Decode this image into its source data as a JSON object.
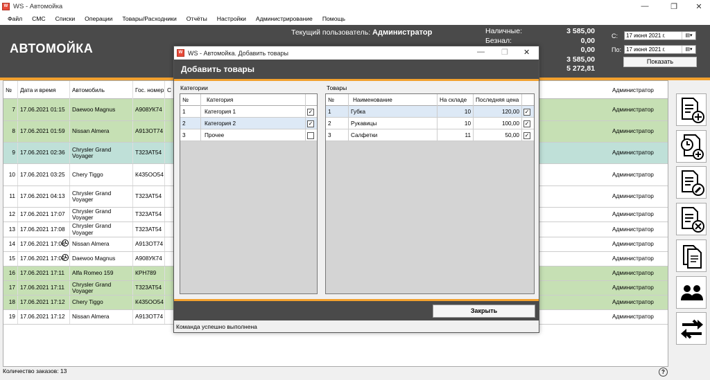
{
  "window": {
    "title": "WS - Автомойка",
    "minimize": "—",
    "maximize": "❐",
    "close": "✕"
  },
  "menu": [
    "Файл",
    "СМС",
    "Списки",
    "Операции",
    "Товары/Расходники",
    "Отчёты",
    "Настройки",
    "Администрирование",
    "Помощь"
  ],
  "header": {
    "app_title": "АВТОМОЙКА",
    "user_label": "Текущий пользователь:",
    "user_value": "Администратор",
    "cash": [
      {
        "label": "Наличные:",
        "value": "3 585,00"
      },
      {
        "label": "Безнал:",
        "value": "0,00"
      },
      {
        "label": "",
        "value": "0,00"
      },
      {
        "label": "",
        "value": "3 585,00"
      },
      {
        "label": "",
        "value": "5 272,81"
      }
    ],
    "date_from_label": "С:",
    "date_from": "17   июня   2021 г.",
    "date_to_label": "По:",
    "date_to": "17   июня   2021 г.",
    "show_button": "Показать"
  },
  "grid": {
    "columns": [
      "№",
      "Дата и время",
      "Автомобиль",
      "Гос. номер",
      "С",
      "Администратор"
    ],
    "rows": [
      {
        "n": "7",
        "dt": "17.06.2021 01:15",
        "car": "Daewoo Magnus",
        "plate": "А908УК74",
        "admin": "Администратор",
        "color": "#c6e0b4",
        "clock": false
      },
      {
        "n": "8",
        "dt": "17.06.2021 01:59",
        "car": "Nissan Almera",
        "plate": "А913ОТ74",
        "admin": "Администратор",
        "color": "#c6e0b4",
        "clock": false
      },
      {
        "n": "9",
        "dt": "17.06.2021 02:36",
        "car": "Chrysler Grand Voyager",
        "plate": "Т323АТ54",
        "admin": "Администратор",
        "color": "#bfe0d8",
        "clock": false
      },
      {
        "n": "10",
        "dt": "17.06.2021 03:25",
        "car": "Chery Tiggo",
        "plate": "К435ОО54",
        "admin": "Администратор",
        "color": "#ffffff",
        "clock": false
      },
      {
        "n": "11",
        "dt": "17.06.2021 04:13",
        "car": "Chrysler Grand Voyager",
        "plate": "Т323АТ54",
        "admin": "Администратор",
        "color": "#ffffff",
        "clock": false
      },
      {
        "n": "12",
        "dt": "17.06.2021 17:07",
        "car": "Chrysler Grand Voyager",
        "plate": "Т323АТ54",
        "admin": "Администратор",
        "color": "#ffffff",
        "clock": false
      },
      {
        "n": "13",
        "dt": "17.06.2021 17:08",
        "car": "Chrysler Grand Voyager",
        "plate": "Т323АТ54",
        "admin": "Администратор",
        "color": "#ffffff",
        "clock": false
      },
      {
        "n": "14",
        "dt": "17.06.2021 17:08",
        "car": "Nissan Almera",
        "plate": "А913ОТ74",
        "admin": "Администратор",
        "color": "#ffffff",
        "clock": true
      },
      {
        "n": "15",
        "dt": "17.06.2021 17:09",
        "car": "Daewoo Magnus",
        "plate": "А908УК74",
        "admin": "Администратор",
        "color": "#ffffff",
        "clock": true
      },
      {
        "n": "16",
        "dt": "17.06.2021 17:11",
        "car": "Alfa Romeo 159",
        "plate": "КРН789",
        "admin": "Администратор",
        "color": "#c6e0b4",
        "clock": false
      },
      {
        "n": "17",
        "dt": "17.06.2021 17:11",
        "car": "Chrysler Grand Voyager",
        "plate": "Т323АТ54",
        "admin": "Администратор",
        "color": "#c6e0b4",
        "clock": false
      },
      {
        "n": "18",
        "dt": "17.06.2021 17:12",
        "car": "Chery Tiggo",
        "plate": "К435ОО54",
        "admin": "Администратор",
        "color": "#c6e0b4",
        "clock": false
      },
      {
        "n": "19",
        "dt": "17.06.2021 17:12",
        "car": "Nissan Almera",
        "plate": "А913ОТ74",
        "admin": "Администратор",
        "color": "#ffffff",
        "clock": false
      }
    ]
  },
  "status": {
    "orders_count": "Количество заказов: 13",
    "help": "?"
  },
  "side_buttons": [
    "add-order-icon",
    "timed-order-icon",
    "edit-order-icon",
    "delete-order-icon",
    "documents-icon",
    "users-icon",
    "transfer-icon"
  ],
  "dialog": {
    "title": "WS - Автомойка. Добавить товары",
    "header": "Добавить товары",
    "categories_label": "Категории",
    "categories_columns": [
      "№",
      "Категория"
    ],
    "categories": [
      {
        "n": "1",
        "name": "Категория 1",
        "checked": true,
        "sel": false
      },
      {
        "n": "2",
        "name": "Категория 2",
        "checked": true,
        "sel": true
      },
      {
        "n": "3",
        "name": "Прочее",
        "checked": false,
        "sel": false
      }
    ],
    "goods_label": "Товары",
    "goods_columns": [
      "№",
      "Наименование",
      "На складе",
      "Последняя цена"
    ],
    "goods": [
      {
        "n": "1",
        "name": "Губка",
        "stock": "10",
        "price": "120,00",
        "checked": true,
        "sel": true
      },
      {
        "n": "2",
        "name": "Рукавицы",
        "stock": "10",
        "price": "100,00",
        "checked": true,
        "sel": false
      },
      {
        "n": "3",
        "name": "Салфетки",
        "stock": "11",
        "price": "50,00",
        "checked": true,
        "sel": false
      }
    ],
    "close_button": "Закрыть",
    "status": "Команда успешно выполнена"
  },
  "colors": {
    "header_bg": "#4a4a4a",
    "accent": "#f2a12e",
    "row_green": "#c6e0b4",
    "row_teal": "#bfe0d8"
  }
}
